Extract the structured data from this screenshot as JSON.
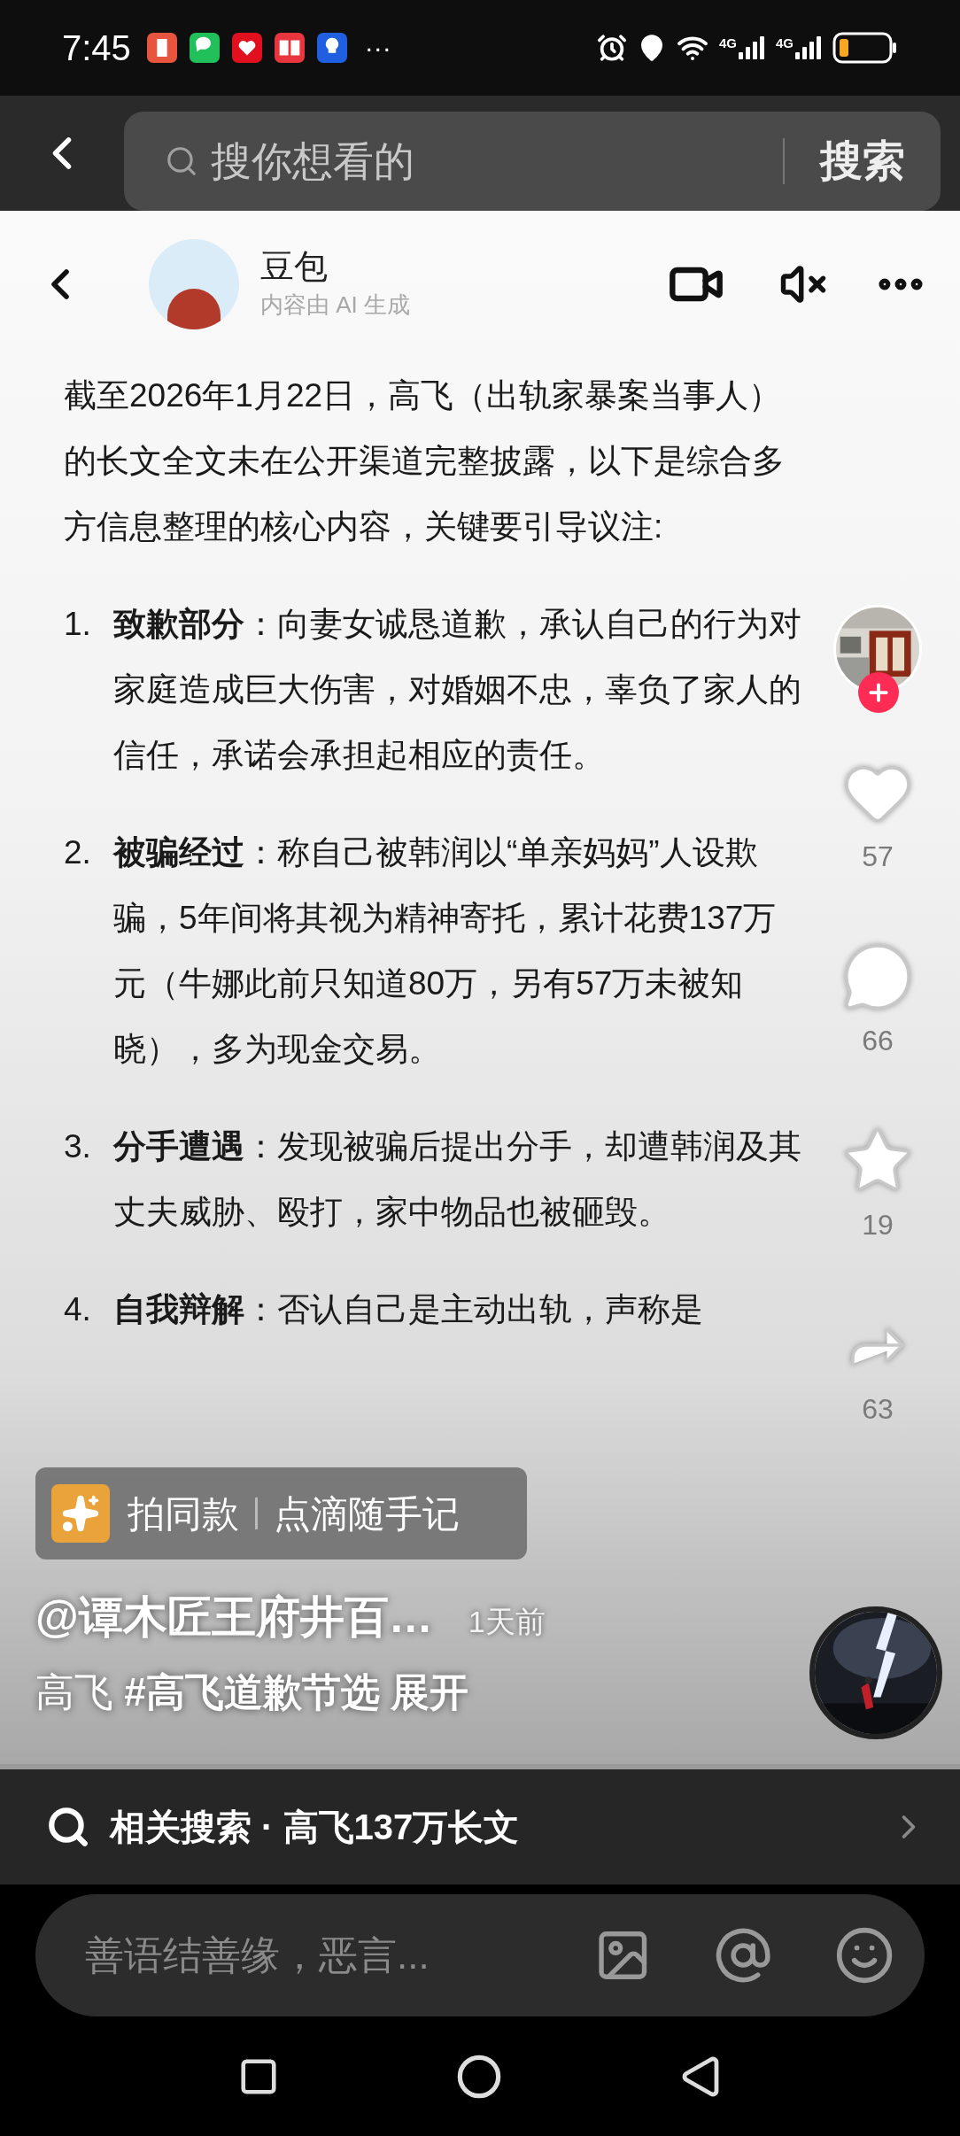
{
  "status_bar": {
    "time": "7:45",
    "notification_apps": [
      {
        "color": "#e8553e"
      },
      {
        "color": "#22c05a"
      },
      {
        "color": "#e0101e"
      },
      {
        "color": "#e8353e"
      },
      {
        "color": "#1f5fe0"
      }
    ],
    "more": "···",
    "signals": [
      "4G",
      "4G"
    ]
  },
  "search_bar": {
    "placeholder": "搜你想看的",
    "button": "搜索"
  },
  "video": {
    "chat_header": {
      "name": "豆包",
      "subtitle": "内容由 AI 生成"
    },
    "intro": "截至2026年1月22日，高飞（出轨家暴案当事人）的长文全文未在公开渠道完整披露，以下是综合多方信息整理的核心内容，关键要引导议注:",
    "items": [
      {
        "number": "1.",
        "title": "致歉部分",
        "text": "：向妻女诚恳道歉，承认自己的行为对家庭造成巨大伤害，对婚姻不忠，辜负了家人的信任，承诺会承担起相应的责任。"
      },
      {
        "number": "2.",
        "title": "被骗经过",
        "text": "：称自己被韩润以“单亲妈妈”人设欺骗，5年间将其视为精神寄托，累计花费137万元（牛娜此前只知道80万，另有57万未被知晓），多为现金交易。"
      },
      {
        "number": "3.",
        "title": "分手遭遇",
        "text": "：发现被骗后提出分手，却遭韩润及其丈夫威胁、殴打，家中物品也被砸毁。"
      },
      {
        "number": "4.",
        "title": "自我辩解",
        "text": "：否认自己是主动出轨，声称是"
      }
    ],
    "rail": {
      "likes": "57",
      "comments": "66",
      "favorites": "19",
      "shares": "63"
    },
    "pill": {
      "left": "拍同款",
      "right": "点滴随手记"
    },
    "author": "@谭木匠王府井百…",
    "time": "1天前",
    "caption": {
      "text": "高飞",
      "hashtag": "#高飞道歉节选",
      "expand": "展开"
    }
  },
  "related_search": {
    "label": "相关搜索 · 高飞137万长文"
  },
  "comment_input": {
    "placeholder": "善语结善缘，恶言..."
  }
}
